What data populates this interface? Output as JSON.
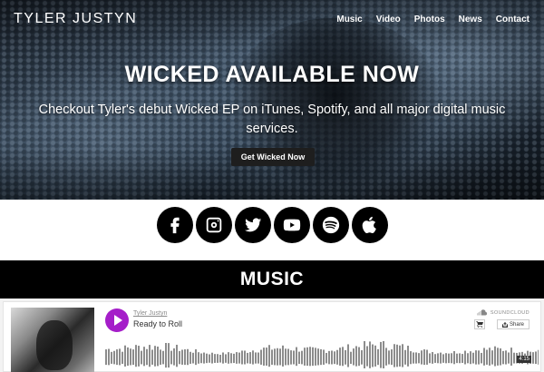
{
  "header": {
    "logo": "TYLER JUSTYN",
    "nav": [
      "Music",
      "Video",
      "Photos",
      "News",
      "Contact"
    ]
  },
  "hero": {
    "title": "WICKED AVAILABLE NOW",
    "subtitle": "Checkout Tyler's debut Wicked EP on iTunes, Spotify, and all major digital music services.",
    "button": "Get Wicked Now"
  },
  "social": [
    "facebook-icon",
    "instagram-icon",
    "twitter-icon",
    "youtube-icon",
    "spotify-icon",
    "apple-icon"
  ],
  "music": {
    "heading": "MUSIC"
  },
  "player": {
    "artist": "Tyler Justyn",
    "track": "Ready to Roll",
    "brand": "SOUNDCLOUD",
    "share_label": "Share",
    "duration": "4:15",
    "accent": "#a51ec9"
  }
}
